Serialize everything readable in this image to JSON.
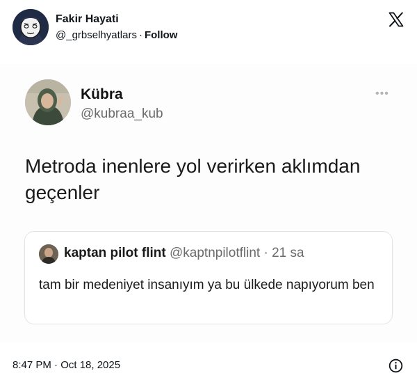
{
  "embed": {
    "display_name": "Fakir Hayati",
    "handle": "@_grbselhyatlars",
    "separator": "·",
    "follow_label": "Follow",
    "avatar_icon": "cartoon-face-avatar",
    "logo_icon": "x-logo"
  },
  "tweet": {
    "author_name": "Kübra",
    "author_handle": "@kubraa_kub",
    "more_icon": "ellipsis",
    "text": "Metroda inenlere yol verirken aklımdan geçenler",
    "quote": {
      "author_name": "kaptan pilot flint",
      "author_handle": "@kaptnpilotflint",
      "separator": "·",
      "time": "21 sa",
      "text": "tam bir medeniyet insanıyım ya bu ülkede napıyorum ben"
    }
  },
  "footer": {
    "timestamp": "8:47 PM · Oct 18, 2025",
    "info_icon": "info-circle"
  },
  "colors": {
    "text_primary": "#0f1419",
    "text_secondary": "#6b6b6b",
    "border": "#e3e3e3"
  }
}
